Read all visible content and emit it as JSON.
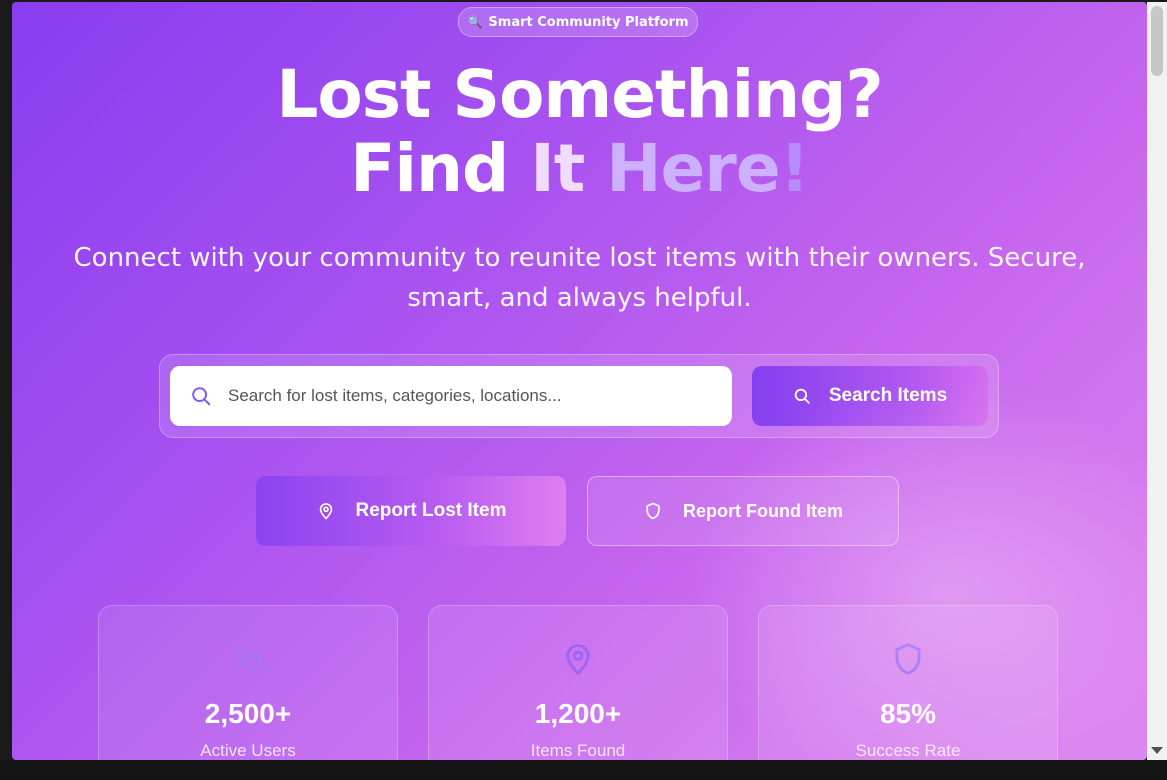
{
  "badge": {
    "icon": "magnifier-icon",
    "label": "Smart Community Platform"
  },
  "hero": {
    "title_line1": "Lost Something?",
    "title_find": "Find ",
    "title_it": "It ",
    "title_here": "Here",
    "title_bang": "!",
    "subtitle": "Connect with your community to reunite lost items with their owners. Secure, smart, and always helpful."
  },
  "search": {
    "placeholder": "Search for lost items, categories, locations...",
    "value": "",
    "button_label": "Search Items"
  },
  "actions": {
    "report_lost_label": "Report Lost Item",
    "report_found_label": "Report Found Item"
  },
  "stats": [
    {
      "icon": "users-icon",
      "value": "2,500+",
      "label": "Active Users"
    },
    {
      "icon": "map-pin-icon",
      "value": "1,200+",
      "label": "Items Found"
    },
    {
      "icon": "shield-icon",
      "value": "85%",
      "label": "Success Rate"
    }
  ],
  "colors": {
    "gradient_start": "#8a3df0",
    "gradient_end": "#dd88f0",
    "icon_accent": "#8f63f5"
  }
}
